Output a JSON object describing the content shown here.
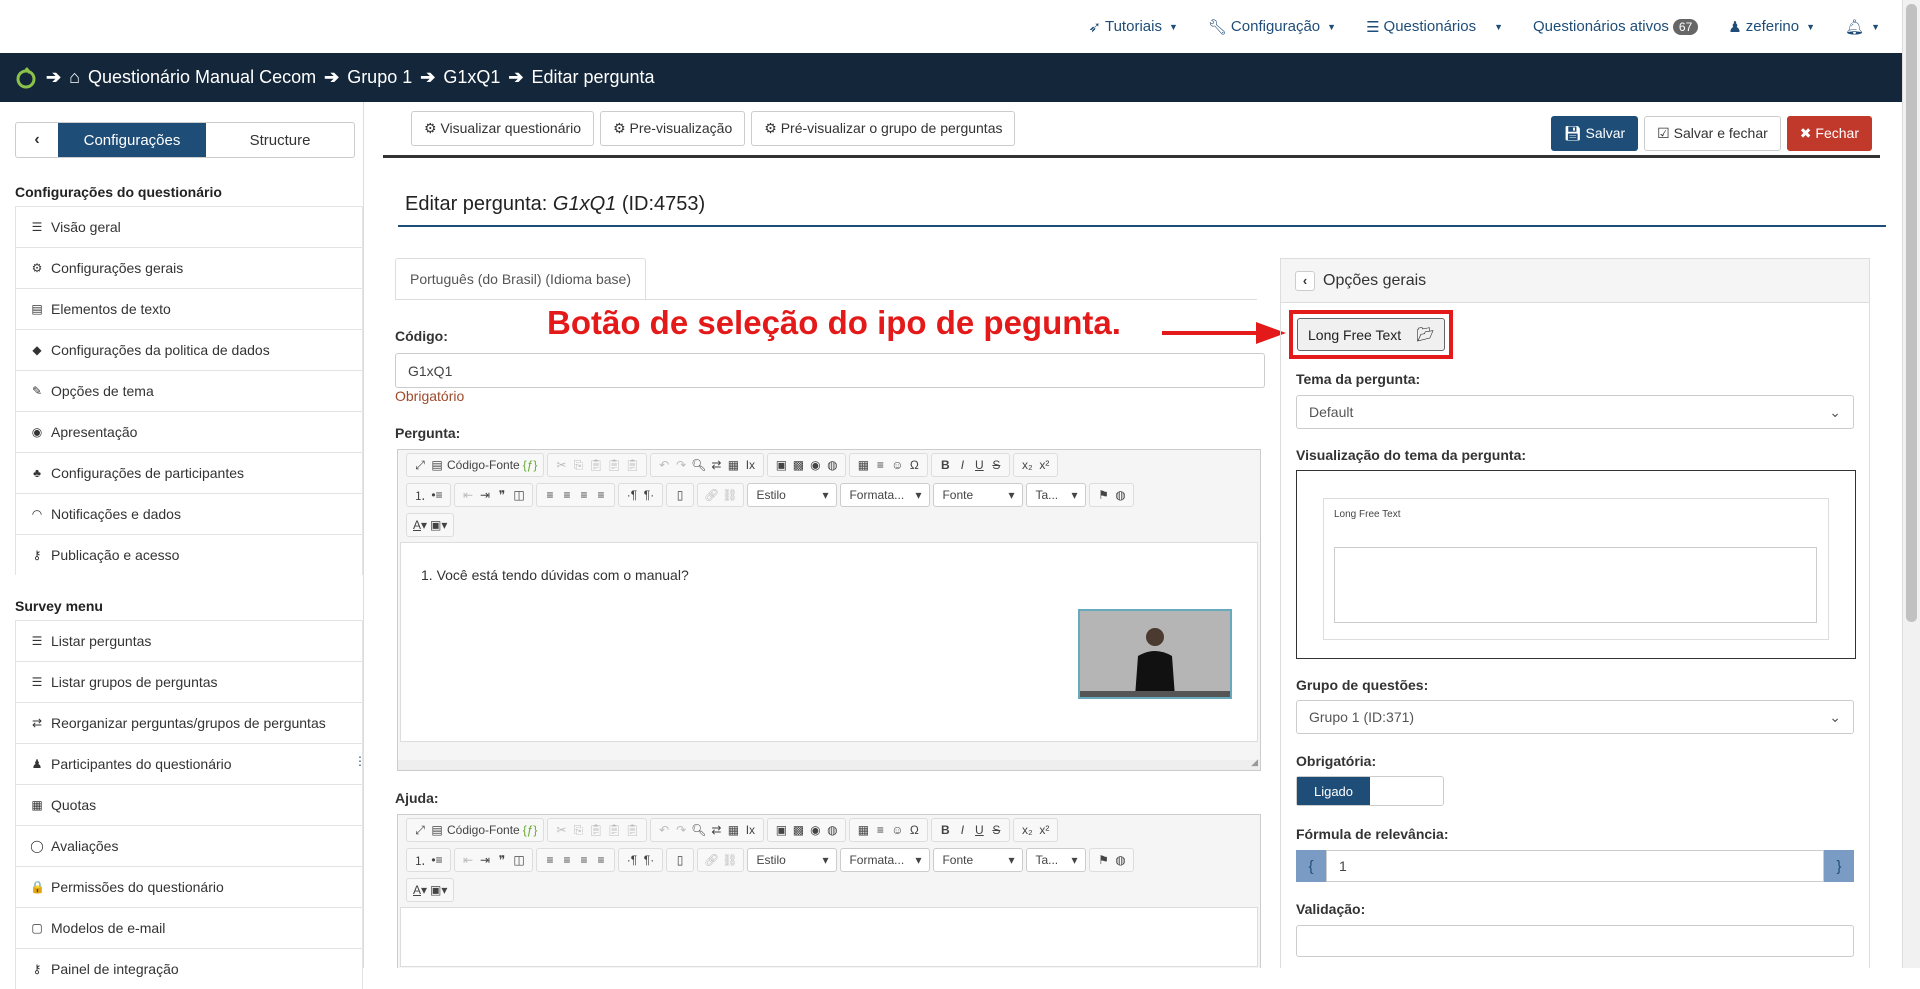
{
  "topnav": {
    "tutoriais": "Tutoriais",
    "configuracao": "Configuração",
    "questionarios": "Questionários",
    "ativos": "Questionários ativos",
    "ativos_count": "67",
    "user": "zeferino"
  },
  "breadcrumb": [
    "Questionário Manual Cecom",
    "Grupo 1",
    "G1xQ1",
    "Editar pergunta"
  ],
  "sidebar": {
    "tab_active": "Configurações",
    "tab_other": "Structure",
    "section1": "Configurações do questionário",
    "items1": [
      {
        "icon": "☰",
        "label": "Visão geral"
      },
      {
        "icon": "⚙",
        "label": "Configurações gerais"
      },
      {
        "icon": "▤",
        "label": "Elementos de texto"
      },
      {
        "icon": "◆",
        "label": "Configurações da politica de dados"
      },
      {
        "icon": "✎",
        "label": "Opções de tema"
      },
      {
        "icon": "◉",
        "label": "Apresentação"
      },
      {
        "icon": "♣",
        "label": "Configurações de participantes"
      },
      {
        "icon": "◠",
        "label": "Notificações e dados"
      },
      {
        "icon": "⚷",
        "label": "Publicação e acesso"
      }
    ],
    "section2": "Survey menu",
    "items2": [
      {
        "icon": "☰",
        "label": "Listar perguntas"
      },
      {
        "icon": "☰",
        "label": "Listar grupos de perguntas"
      },
      {
        "icon": "⇄",
        "label": "Reorganizar perguntas/grupos de perguntas"
      },
      {
        "icon": "♟",
        "label": "Participantes do questionário"
      },
      {
        "icon": "▦",
        "label": "Quotas"
      },
      {
        "icon": "◯",
        "label": "Avaliações"
      },
      {
        "icon": "🔒",
        "label": "Permissões do questionário"
      },
      {
        "icon": "▢",
        "label": "Modelos de e-mail"
      },
      {
        "icon": "⚷",
        "label": "Painel de integração"
      }
    ]
  },
  "toolbar": {
    "view_survey": "Visualizar questionário",
    "preview": "Pre-visualização",
    "preview_group": "Pré-visualizar o grupo de perguntas",
    "save": "Salvar",
    "save_close": "Salvar e fechar",
    "close": "Fechar"
  },
  "page": {
    "title_prefix": "Editar pergunta:",
    "title_code": "G1xQ1",
    "title_id": "(ID:4753)",
    "lang_tab": "Português (do Brasil) (Idioma base)",
    "code_label": "Código:",
    "code_value": "G1xQ1",
    "required_note": "Obrigatório",
    "question_label": "Pergunta:",
    "question_text": "1. Você está tendo dúvidas com o manual?",
    "help_label": "Ajuda:",
    "editor_source": "Código-Fonte",
    "editor_style": "Estilo",
    "editor_format": "Formata...",
    "editor_font": "Fonte",
    "editor_size": "Ta..."
  },
  "annotation": "Botão de seleção do ipo de pegunta.",
  "right_panel": {
    "title": "Opções gerais",
    "type_button": "Long Free Text",
    "theme_label": "Tema da pergunta:",
    "theme_value": "Default",
    "theme_preview_label": "Visualização do tema da pergunta:",
    "preview_text": "Long Free Text",
    "group_label": "Grupo de questões:",
    "group_value": "Grupo 1 (ID:371)",
    "mandatory_label": "Obrigatória:",
    "mandatory_on": "Ligado",
    "relevance_label": "Fórmula de relevância:",
    "relevance_value": "1",
    "validation_label": "Validação:"
  },
  "colors": {
    "nav_dark": "#14263a",
    "primary": "#1e4d78",
    "danger": "#c0392b",
    "annotation": "#e41a1a"
  }
}
